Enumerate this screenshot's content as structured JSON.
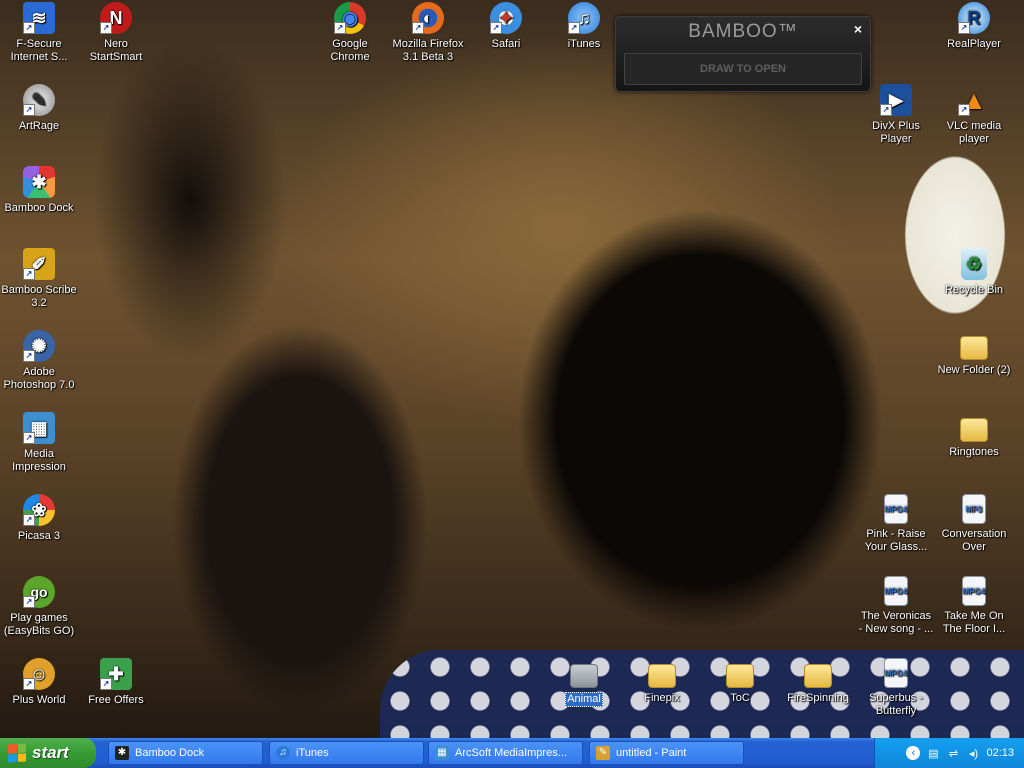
{
  "desktop": {
    "icons": [
      {
        "id": "fsecure",
        "label": "F-Secure Internet S...",
        "glyph": "≋",
        "color": "#2a6ad4",
        "shortcut": true
      },
      {
        "id": "nero",
        "label": "Nero StartSmart",
        "glyph": "N",
        "color": "#c01a1a",
        "shortcut": true
      },
      {
        "id": "chrome",
        "label": "Google Chrome",
        "glyph": "◉",
        "color": "#d8392b",
        "shortcut": true
      },
      {
        "id": "firefox",
        "label": "Mozilla Firefox 3.1 Beta 3",
        "glyph": "◐",
        "color": "#e66a1b",
        "shortcut": true
      },
      {
        "id": "safari",
        "label": "Safari",
        "glyph": "✦",
        "color": "#3b8ee0",
        "shortcut": true
      },
      {
        "id": "itunes",
        "label": "iTunes",
        "glyph": "♫",
        "color": "#2b7ad8",
        "shortcut": true
      },
      {
        "id": "realplayer",
        "label": "RealPlayer",
        "glyph": "R",
        "color": "#1e7fd6",
        "shortcut": true
      },
      {
        "id": "artrage",
        "label": "ArtRage",
        "glyph": "✎",
        "color": "#8a8a8a",
        "shortcut": true
      },
      {
        "id": "bamboodock",
        "label": "Bamboo Dock",
        "glyph": "✱",
        "color": "#333",
        "shortcut": false
      },
      {
        "id": "bambooscribe",
        "label": "Bamboo Scribe 3.2",
        "glyph": "✐",
        "color": "#d7a318",
        "shortcut": true
      },
      {
        "id": "photoshop",
        "label": "Adobe Photoshop 7.0",
        "glyph": "✺",
        "color": "#3a64a8",
        "shortcut": true
      },
      {
        "id": "mediaimpression",
        "label": "Media Impression",
        "glyph": "▦",
        "color": "#3c8fd0",
        "shortcut": true
      },
      {
        "id": "picasa",
        "label": "Picasa 3",
        "glyph": "❀",
        "color": "#d04da0",
        "shortcut": true
      },
      {
        "id": "easybits",
        "label": "Play games (EasyBits GO)",
        "glyph": "go",
        "color": "#5aa52a",
        "shortcut": true
      },
      {
        "id": "plusworld",
        "label": "Plus World",
        "glyph": "☺",
        "color": "#e0a02a",
        "shortcut": true
      },
      {
        "id": "freeoffers",
        "label": "Free Offers",
        "glyph": "✚",
        "color": "#3aa04c",
        "shortcut": true
      },
      {
        "id": "divx",
        "label": "DivX Plus Player",
        "glyph": "▶",
        "color": "#1c4f9c",
        "shortcut": true
      },
      {
        "id": "vlc",
        "label": "VLC media player",
        "glyph": "▲",
        "color": "#f08a14",
        "shortcut": true
      },
      {
        "id": "recyclebin",
        "label": "Recycle Bin",
        "glyph": "♻",
        "color": "#4aa0c8",
        "shortcut": false
      },
      {
        "id": "newfolder2",
        "label": "New Folder (2)",
        "glyph": "",
        "color": "",
        "shortcut": false
      },
      {
        "id": "ringtones",
        "label": "Ringtones",
        "glyph": "",
        "color": "",
        "shortcut": false
      },
      {
        "id": "pink",
        "label": "Pink - Raise Your Glass...",
        "glyph": "MPG4",
        "color": "",
        "shortcut": false
      },
      {
        "id": "conversation",
        "label": "Conversation Over",
        "glyph": "MP3",
        "color": "",
        "shortcut": false
      },
      {
        "id": "veronicas",
        "label": "The Veronicas - New song - ...",
        "glyph": "MPG4",
        "color": "",
        "shortcut": false
      },
      {
        "id": "takemeon",
        "label": "Take Me On The Floor I...",
        "glyph": "MPG4",
        "color": "",
        "shortcut": false
      },
      {
        "id": "superbus",
        "label": "Superbus - Butterfly",
        "glyph": "MPG4",
        "color": "",
        "shortcut": false
      },
      {
        "id": "animal",
        "label": "Animal",
        "glyph": "",
        "color": "",
        "shortcut": false
      },
      {
        "id": "finepix",
        "label": "Finepix",
        "glyph": "",
        "color": "",
        "shortcut": false
      },
      {
        "id": "toc",
        "label": "ToC",
        "glyph": "",
        "color": "",
        "shortcut": false
      },
      {
        "id": "firespinning",
        "label": "FireSpinning",
        "glyph": "",
        "color": "",
        "shortcut": false
      }
    ]
  },
  "bamboo_widget": {
    "title": "BAMBOO™",
    "close": "×",
    "draw_label": "DRAW TO OPEN"
  },
  "taskbar": {
    "start_label": "start",
    "tasks": [
      {
        "label": "Bamboo Dock",
        "icon": "✱",
        "color": "#222"
      },
      {
        "label": "iTunes",
        "icon": "♫",
        "color": "#2b7ad8"
      },
      {
        "label": "ArcSoft MediaImpres...",
        "icon": "▦",
        "color": "#3c8fd0"
      },
      {
        "label": "untitled - Paint",
        "icon": "✎",
        "color": "#d9a030"
      }
    ],
    "help": "?",
    "clock": "02:13"
  }
}
